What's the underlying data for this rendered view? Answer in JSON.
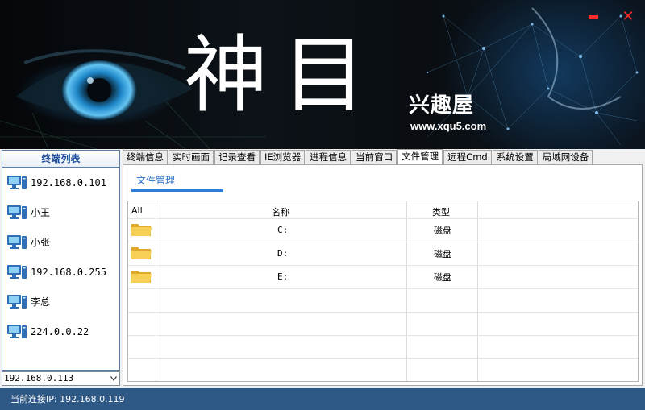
{
  "banner": {
    "title": "神目",
    "brand_logo": "兴趣屋",
    "brand_url": "www.xqu5.com"
  },
  "window_controls": {
    "minimize_icon": "minimize-icon",
    "close_icon": "close-icon",
    "close_symbol": "✕",
    "color": "#ff2a2a"
  },
  "terminal_panel": {
    "header": "终端列表",
    "items": [
      {
        "label": "192.168.0.101",
        "icon": "computer-icon"
      },
      {
        "label": "小王",
        "icon": "computer-icon"
      },
      {
        "label": "小张",
        "icon": "computer-icon"
      },
      {
        "label": "192.168.0.255",
        "icon": "computer-icon"
      },
      {
        "label": "李总",
        "icon": "computer-icon"
      },
      {
        "label": "224.0.0.22",
        "icon": "computer-icon"
      }
    ],
    "selected_ip": "192.168.0.113"
  },
  "tabs": [
    {
      "label": "终端信息"
    },
    {
      "label": "实时画面"
    },
    {
      "label": "记录查看"
    },
    {
      "label": "IE浏览器"
    },
    {
      "label": "进程信息"
    },
    {
      "label": "当前窗口"
    },
    {
      "label": "文件管理",
      "active": true
    },
    {
      "label": "远程Cmd"
    },
    {
      "label": "系统设置"
    },
    {
      "label": "局域网设备"
    }
  ],
  "file_manager": {
    "subtab": "文件管理",
    "columns": {
      "all": "All",
      "name": "名称",
      "type": "类型"
    },
    "rows": [
      {
        "name": "C:",
        "type": "磁盘",
        "icon": "folder-icon"
      },
      {
        "name": "D:",
        "type": "磁盘",
        "icon": "folder-icon"
      },
      {
        "name": "E:",
        "type": "磁盘",
        "icon": "folder-icon"
      }
    ]
  },
  "status_bar": {
    "text": "当前连接IP: 192.168.0.119"
  },
  "colors": {
    "status_bar": "#2e5886",
    "accent": "#2b7fd6",
    "panel_border": "#5a7ea6"
  }
}
